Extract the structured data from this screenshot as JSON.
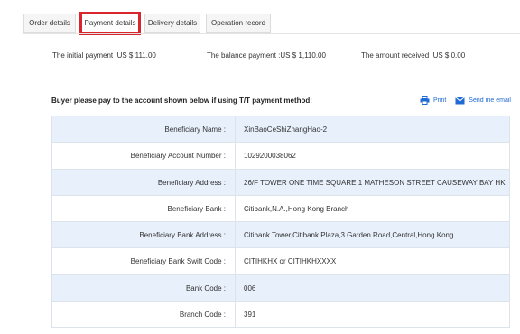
{
  "tabs": [
    {
      "label": "Order details",
      "active": false
    },
    {
      "label": "Payment details",
      "active": true
    },
    {
      "label": "Delivery details",
      "active": false
    },
    {
      "label": "Operation record",
      "active": false
    }
  ],
  "payments": {
    "initial": "The initial payment :US $ 111.00",
    "balance": "The balance payment :US $ 1,110.00",
    "received": "The amount received :US $ 0.00"
  },
  "instruction": "Buyer please pay to the account shown below if using T/T payment method:",
  "actions": {
    "print": "Print",
    "email": "Send me email",
    "print_icon": "printer-icon",
    "email_icon": "envelope-icon"
  },
  "details": [
    {
      "label": "Beneficiary Name :",
      "value": "XinBaoCeShiZhangHao-2"
    },
    {
      "label": "Beneficiary Account Number :",
      "value": "1029200038062"
    },
    {
      "label": "Beneficiary Address :",
      "value": "26/F TOWER ONE TIME SQUARE 1 MATHESON STREET CAUSEWAY BAY HK"
    },
    {
      "label": "Beneficiary Bank :",
      "value": "Citibank,N.A.,Hong Kong Branch"
    },
    {
      "label": "Beneficiary Bank Address :",
      "value": "Citibank Tower,Citibank Plaza,3 Garden Road,Central,Hong Kong"
    },
    {
      "label": "Beneficiary Bank Swift Code :",
      "value": "CITIHKHX or CITIHKHXXXX"
    },
    {
      "label": "Bank Code :",
      "value": "006"
    },
    {
      "label": "Branch Code :",
      "value": "391"
    }
  ],
  "colors": {
    "active_tab_outline": "#d9262c",
    "link": "#1f6bd3",
    "row_alt": "#e8f0fb"
  }
}
